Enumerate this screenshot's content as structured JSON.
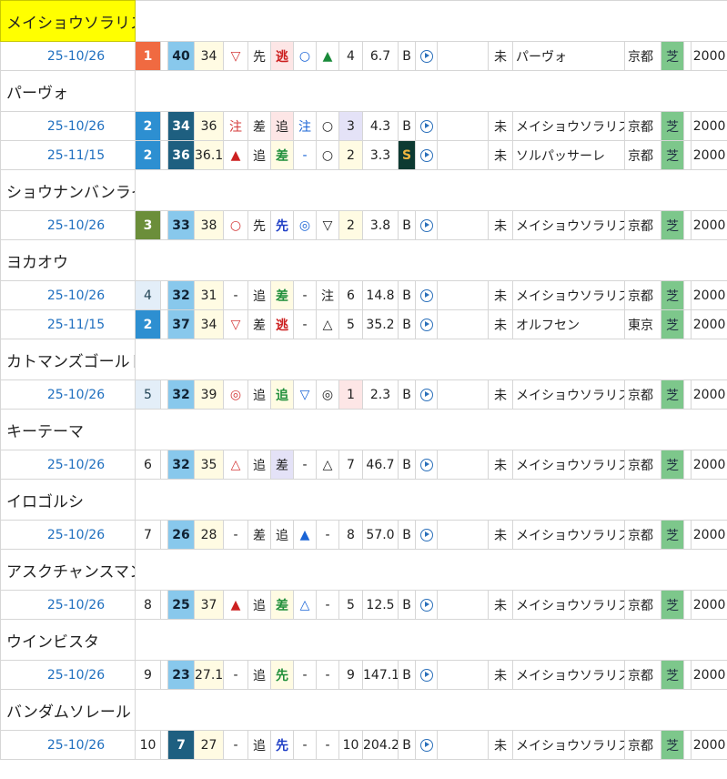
{
  "groups": [
    {
      "name": "メイショウソラリス",
      "selected": true,
      "rows": [
        {
          "date": "25-10/26",
          "rank": "1",
          "rank_style": "r-red",
          "score": "40",
          "score_style": "sc-light",
          "v1": "34",
          "m1": "▽",
          "m1c": "red",
          "p1": "先",
          "p2": "逃",
          "p2c": "boldred",
          "p2bg": "pinkbg",
          "m2": "○",
          "m2c": "tri-blue",
          "m3": "▲",
          "m3c": "tri-green",
          "num": "4",
          "numbg": "",
          "odds": "6.7",
          "b": "B",
          "s": "",
          "cls": "未",
          "opp": "パーヴォ",
          "place": "京都",
          "turf": "芝",
          "dist": "2000"
        }
      ]
    },
    {
      "name": "パーヴォ",
      "rows": [
        {
          "date": "25-10/26",
          "rank": "2",
          "rank_style": "r-blue",
          "score": "34",
          "score_style": "sc-dark",
          "v1": "36",
          "m1": "注",
          "m1c": "red",
          "p1": "差",
          "p2": "追",
          "p2c": "",
          "p2bg": "pinkbg",
          "m2": "注",
          "m2c": "tri-blue",
          "m3": "○",
          "m3c": "",
          "num": "3",
          "numbg": "lilac",
          "odds": "4.3",
          "b": "B",
          "s": "",
          "cls": "未",
          "opp": "メイショウソラリス",
          "place": "京都",
          "turf": "芝",
          "dist": "2000"
        },
        {
          "date": "25-11/15",
          "rank": "2",
          "rank_style": "r-blue",
          "score": "36",
          "score_style": "sc-dark",
          "v1": "36.1",
          "m1": "▲",
          "m1c": "tri-red",
          "p1": "追",
          "p2": "差",
          "p2c": "green",
          "p2bg": "cream",
          "m2": "-",
          "m2c": "tri-blue",
          "m3": "○",
          "m3c": "",
          "num": "2",
          "numbg": "cream",
          "odds": "3.3",
          "b": "S",
          "s": "S",
          "cls": "未",
          "opp": "ソルパッサーレ",
          "place": "京都",
          "turf": "芝",
          "dist": "2000"
        }
      ]
    },
    {
      "name": "ショウナンバンライ",
      "rows": [
        {
          "date": "25-10/26",
          "rank": "3",
          "rank_style": "r-olive",
          "score": "33",
          "score_style": "sc-light",
          "v1": "38",
          "m1": "○",
          "m1c": "red",
          "p1": "先",
          "p2": "先",
          "p2c": "blue",
          "p2bg": "",
          "m2": "◎",
          "m2c": "tri-blue",
          "m3": "▽",
          "m3c": "",
          "num": "2",
          "numbg": "cream",
          "odds": "3.8",
          "b": "B",
          "s": "",
          "cls": "未",
          "opp": "メイショウソラリス",
          "place": "京都",
          "turf": "芝",
          "dist": "2000"
        }
      ]
    },
    {
      "name": "ヨカオウ",
      "rows": [
        {
          "date": "25-10/26",
          "rank": "4",
          "rank_style": "r-lblue",
          "score": "32",
          "score_style": "sc-light",
          "v1": "31",
          "m1": "-",
          "m1c": "",
          "p1": "追",
          "p2": "差",
          "p2c": "green",
          "p2bg": "cream",
          "m2": "-",
          "m2c": "",
          "m3": "注",
          "m3c": "",
          "num": "6",
          "numbg": "",
          "odds": "14.8",
          "b": "B",
          "s": "",
          "cls": "未",
          "opp": "メイショウソラリス",
          "place": "京都",
          "turf": "芝",
          "dist": "2000"
        },
        {
          "date": "25-11/15",
          "rank": "2",
          "rank_style": "r-blue",
          "score": "37",
          "score_style": "sc-light",
          "v1": "34",
          "m1": "▽",
          "m1c": "red",
          "p1": "差",
          "p2": "逃",
          "p2c": "boldred",
          "p2bg": "",
          "m2": "-",
          "m2c": "",
          "m3": "△",
          "m3c": "",
          "num": "5",
          "numbg": "",
          "odds": "35.2",
          "b": "B",
          "s": "",
          "cls": "未",
          "opp": "オルフセン",
          "place": "東京",
          "turf": "芝",
          "dist": "2000"
        }
      ]
    },
    {
      "name": "カトマンズゴールド",
      "rows": [
        {
          "date": "25-10/26",
          "rank": "5",
          "rank_style": "r-lblue",
          "score": "32",
          "score_style": "sc-light",
          "v1": "39",
          "m1": "◎",
          "m1c": "red",
          "p1": "追",
          "p2": "追",
          "p2c": "green",
          "p2bg": "cream",
          "m2": "▽",
          "m2c": "tri-blue",
          "m3": "◎",
          "m3c": "",
          "num": "1",
          "numbg": "pinkbg",
          "odds": "2.3",
          "b": "B",
          "s": "",
          "cls": "未",
          "opp": "メイショウソラリス",
          "place": "京都",
          "turf": "芝",
          "dist": "2000"
        }
      ]
    },
    {
      "name": "キーテーマ",
      "rows": [
        {
          "date": "25-10/26",
          "rank": "6",
          "rank_style": "",
          "score": "32",
          "score_style": "sc-light",
          "v1": "35",
          "m1": "△",
          "m1c": "red",
          "p1": "追",
          "p2": "差",
          "p2c": "",
          "p2bg": "lilac",
          "m2": "-",
          "m2c": "",
          "m3": "△",
          "m3c": "",
          "num": "7",
          "numbg": "",
          "odds": "46.7",
          "b": "B",
          "s": "",
          "cls": "未",
          "opp": "メイショウソラリス",
          "place": "京都",
          "turf": "芝",
          "dist": "2000"
        }
      ]
    },
    {
      "name": "イロゴルシ",
      "rows": [
        {
          "date": "25-10/26",
          "rank": "7",
          "rank_style": "",
          "score": "26",
          "score_style": "sc-light",
          "v1": "28",
          "m1": "-",
          "m1c": "",
          "p1": "差",
          "p2": "追",
          "p2c": "",
          "p2bg": "",
          "m2": "▲",
          "m2c": "tri-blue",
          "m3": "-",
          "m3c": "",
          "num": "8",
          "numbg": "",
          "odds": "57.0",
          "b": "B",
          "s": "",
          "cls": "未",
          "opp": "メイショウソラリス",
          "place": "京都",
          "turf": "芝",
          "dist": "2000"
        }
      ]
    },
    {
      "name": "アスクチャンスマン",
      "rows": [
        {
          "date": "25-10/26",
          "rank": "8",
          "rank_style": "",
          "score": "25",
          "score_style": "sc-light",
          "v1": "37",
          "m1": "▲",
          "m1c": "tri-red",
          "p1": "追",
          "p2": "差",
          "p2c": "green",
          "p2bg": "cream",
          "m2": "△",
          "m2c": "tri-blue",
          "m3": "-",
          "m3c": "",
          "num": "5",
          "numbg": "",
          "odds": "12.5",
          "b": "B",
          "s": "",
          "cls": "未",
          "opp": "メイショウソラリス",
          "place": "京都",
          "turf": "芝",
          "dist": "2000"
        }
      ]
    },
    {
      "name": "ウインビスタ",
      "rows": [
        {
          "date": "25-10/26",
          "rank": "9",
          "rank_style": "",
          "score": "23",
          "score_style": "sc-light",
          "v1": "27.1",
          "m1": "-",
          "m1c": "",
          "p1": "追",
          "p2": "先",
          "p2c": "green",
          "p2bg": "cream",
          "m2": "-",
          "m2c": "",
          "m3": "-",
          "m3c": "",
          "num": "9",
          "numbg": "",
          "odds": "147.1",
          "b": "B",
          "s": "",
          "cls": "未",
          "opp": "メイショウソラリス",
          "place": "京都",
          "turf": "芝",
          "dist": "2000"
        }
      ]
    },
    {
      "name": "バンダムソレール",
      "rows": [
        {
          "date": "25-10/26",
          "rank": "10",
          "rank_style": "",
          "score": "7",
          "score_style": "sc-dark",
          "v1": "27",
          "m1": "-",
          "m1c": "",
          "p1": "追",
          "p2": "先",
          "p2c": "blue",
          "p2bg": "",
          "m2": "-",
          "m2c": "",
          "m3": "-",
          "m3c": "",
          "num": "10",
          "numbg": "",
          "odds": "204.2",
          "b": "B",
          "s": "",
          "cls": "未",
          "opp": "メイショウソラリス",
          "place": "京都",
          "turf": "芝",
          "dist": "2000"
        }
      ]
    }
  ]
}
